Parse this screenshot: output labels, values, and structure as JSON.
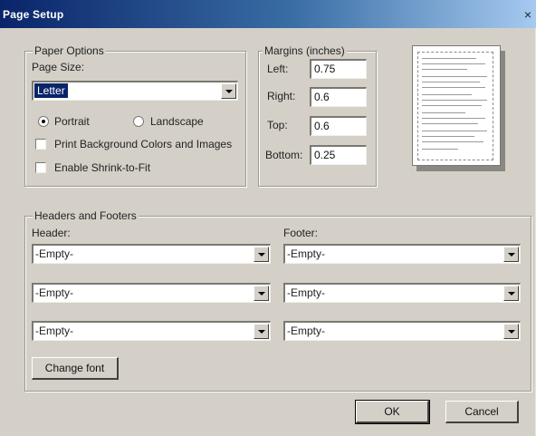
{
  "title": "Page Setup",
  "close_glyph": "×",
  "paper_options": {
    "legend": "Paper Options",
    "page_size_label": "Page Size:",
    "page_size_value": "Letter",
    "orientation": {
      "portrait_label": "Portrait",
      "landscape_label": "Landscape",
      "selected": "portrait"
    },
    "print_background_label": "Print Background Colors and Images",
    "print_background_checked": false,
    "shrink_to_fit_label": "Enable Shrink-to-Fit",
    "shrink_to_fit_checked": false
  },
  "margins": {
    "legend": "Margins (inches)",
    "left_label": "Left:",
    "left_value": "0.75",
    "right_label": "Right:",
    "right_value": "0.6",
    "top_label": "Top:",
    "top_value": "0.6",
    "bottom_label": "Bottom:",
    "bottom_value": "0.25"
  },
  "headers_footers": {
    "legend": "Headers and Footers",
    "header_label": "Header:",
    "footer_label": "Footer:",
    "header_values": [
      "-Empty-",
      "-Empty-",
      "-Empty-"
    ],
    "footer_values": [
      "-Empty-",
      "-Empty-",
      "-Empty-"
    ],
    "change_font_label": "Change font"
  },
  "buttons": {
    "ok_label": "OK",
    "cancel_label": "Cancel"
  },
  "colors": {
    "title_bar": "#0a246a",
    "dialog_face": "#d4d0c8",
    "selection": "#0a246a"
  }
}
